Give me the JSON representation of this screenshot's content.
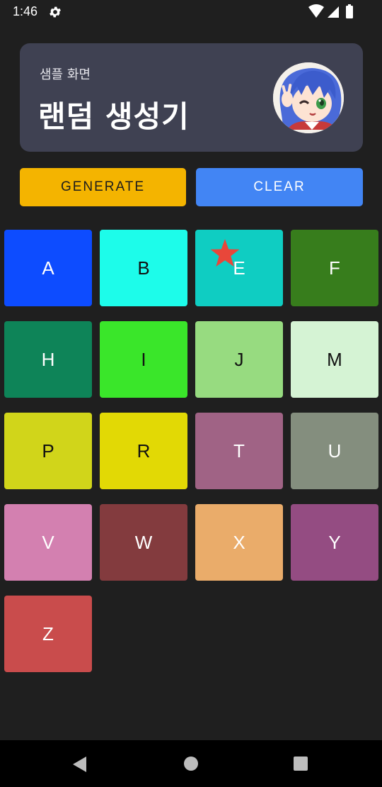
{
  "status_bar": {
    "time": "1:46",
    "settings_icon": "gear-icon",
    "wifi_icon": "wifi-icon",
    "signal_icon": "signal-icon",
    "battery_icon": "battery-icon"
  },
  "header": {
    "subtitle": "샘플 화면",
    "title": "랜덤 생성기",
    "avatar": "anime-character-avatar"
  },
  "buttons": {
    "generate_label": "GENERATE",
    "clear_label": "CLEAR",
    "generate_color": "#f4b400",
    "clear_color": "#4285f4"
  },
  "tiles": [
    {
      "letter": "A",
      "bg": "#0d4cff",
      "fg": "#ffffff"
    },
    {
      "letter": "B",
      "bg": "#1dfcea",
      "fg": "#111111"
    },
    {
      "letter": "E",
      "bg": "#0fcdc2",
      "fg": "#ffffff"
    },
    {
      "letter": "F",
      "bg": "#377d1c",
      "fg": "#ffffff"
    },
    {
      "letter": "H",
      "bg": "#0e8458",
      "fg": "#ffffff"
    },
    {
      "letter": "I",
      "bg": "#3ae62a",
      "fg": "#111111"
    },
    {
      "letter": "J",
      "bg": "#97db80",
      "fg": "#111111"
    },
    {
      "letter": "M",
      "bg": "#d5f3d4",
      "fg": "#111111"
    },
    {
      "letter": "P",
      "bg": "#d1d51a",
      "fg": "#111111"
    },
    {
      "letter": "R",
      "bg": "#e2d905",
      "fg": "#111111"
    },
    {
      "letter": "T",
      "bg": "#a06385",
      "fg": "#ffffff"
    },
    {
      "letter": "U",
      "bg": "#848e7e",
      "fg": "#ffffff"
    },
    {
      "letter": "V",
      "bg": "#d380b0",
      "fg": "#ffffff"
    },
    {
      "letter": "W",
      "bg": "#833b3e",
      "fg": "#ffffff"
    },
    {
      "letter": "X",
      "bg": "#eaac6a",
      "fg": "#ffffff"
    },
    {
      "letter": "Y",
      "bg": "#944c82",
      "fg": "#ffffff"
    },
    {
      "letter": "Z",
      "bg": "#c94c4c",
      "fg": "#ffffff"
    }
  ],
  "star_icon": "star-icon",
  "star_color": "#e8473a",
  "nav": {
    "back_icon": "back-icon",
    "home_icon": "home-icon",
    "recents_icon": "recents-icon"
  }
}
